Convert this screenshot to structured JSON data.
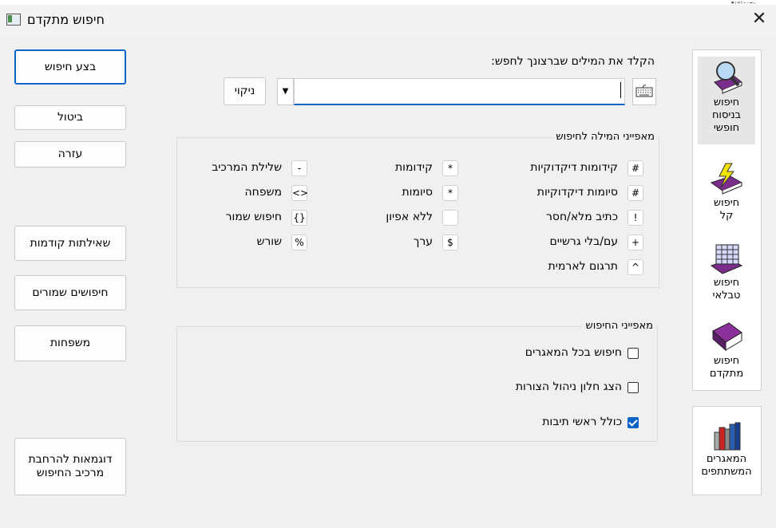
{
  "window": {
    "title": "חיפוש מתקדם",
    "close_glyph": "✕"
  },
  "top_strip_text": "ְֵֶַָֹּּּּּ ּּ ְ ָ ֶ ֵ ִ ַ ֻ ֹ ּ",
  "buttons": {
    "execute": "בצע חיפוש",
    "cancel": "ביטול",
    "help": "עזרה",
    "prev_questions": "שאילתות קודמות",
    "saved_searches": "חיפושים שמורים",
    "families": "משפחות",
    "examples": "דוגמאות להרחבת\nמרכיב החיפוש",
    "clear": "ניקוי"
  },
  "search": {
    "prompt": "הקלד את המילים שברצונך לחפש:",
    "value": ""
  },
  "nav": [
    {
      "label": "חיפוש\nבניסוח\nחופשי",
      "icon": "magnifier-book-icon",
      "selected": true
    },
    {
      "label": "חיפוש\nקל",
      "icon": "lightning-book-icon",
      "selected": false
    },
    {
      "label": "חיפוש\nטבלאי",
      "icon": "table-book-icon",
      "selected": false
    },
    {
      "label": "חיפוש\nמתקדם",
      "icon": "book-icon",
      "selected": false
    }
  ],
  "databases": {
    "label": "המאגרים\nהמשתתפים",
    "icon": "books-icon"
  },
  "word_props": {
    "legend": "מאפייני המילה לחיפוש",
    "col_right": [
      {
        "sym": "#",
        "label": "קידומות דיקדוקיות"
      },
      {
        "sym": "#",
        "label": "סיומות דיקדוקיות"
      },
      {
        "sym": "!",
        "label": "כתיב מלא/חסר"
      },
      {
        "sym": "+",
        "label": "עם/בלי גרשיים"
      },
      {
        "sym": "^",
        "label": "תרגום לארמית"
      }
    ],
    "col_mid": [
      {
        "sym": "*",
        "label": "קידומות"
      },
      {
        "sym": "*",
        "label": "סיומות"
      },
      {
        "sym": "",
        "label": "ללא אפיון"
      },
      {
        "sym": "$",
        "label": "ערך"
      }
    ],
    "col_left": [
      {
        "sym": "-",
        "label": "שלילת המרכיב"
      },
      {
        "sym": "<>",
        "label": "משפחה"
      },
      {
        "sym": "{}",
        "label": "חיפוש שמור"
      },
      {
        "sym": "%",
        "label": "שורש"
      }
    ]
  },
  "search_props": {
    "legend": "מאפייני החיפוש",
    "options": [
      {
        "label": "חיפוש בכל המאגרים",
        "checked": false
      },
      {
        "label": "הצג חלון ניהול הצורות",
        "checked": false
      },
      {
        "label": "כולל ראשי תיבות",
        "checked": true
      }
    ]
  }
}
